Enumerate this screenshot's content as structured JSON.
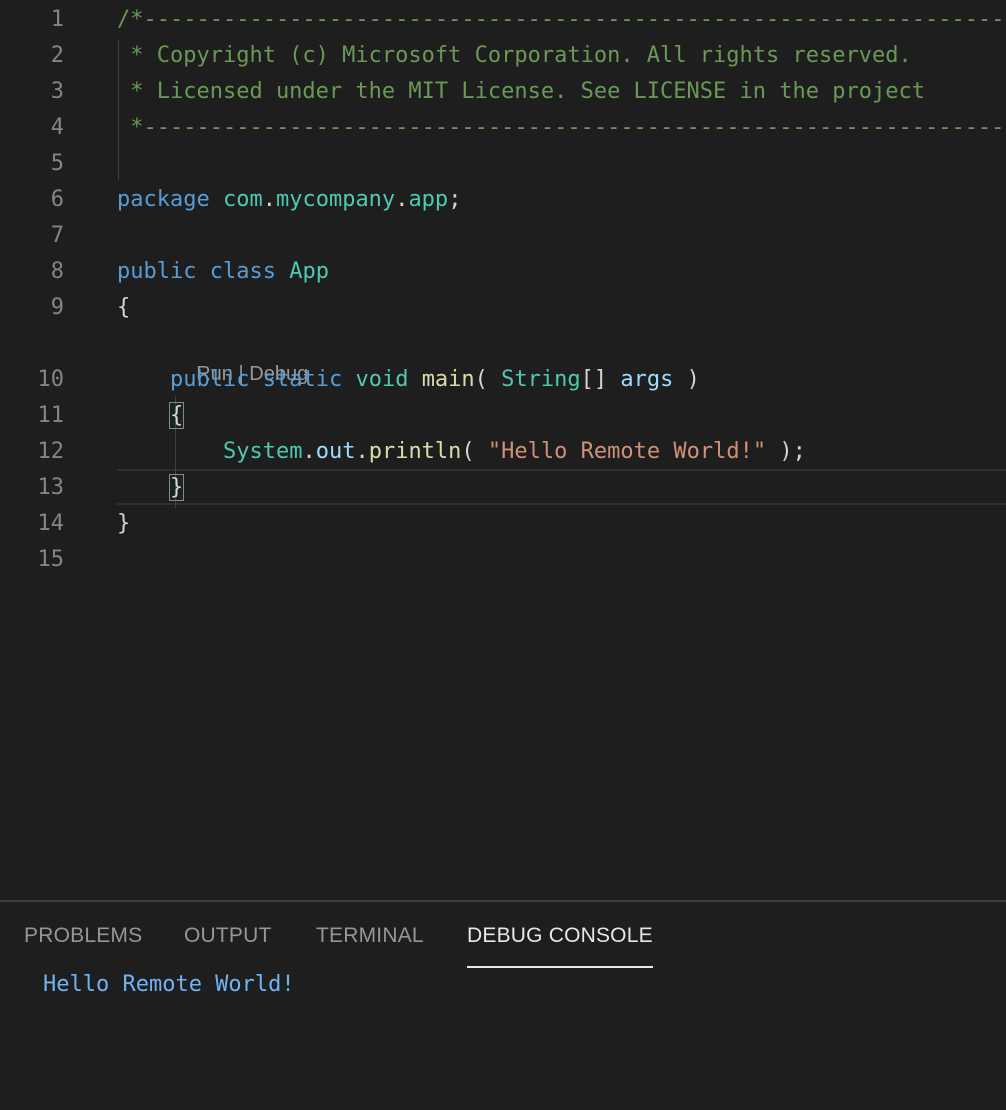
{
  "editor": {
    "language": "java",
    "lines": [
      {
        "number": "1",
        "tokens": [
          {
            "t": "com",
            "v": "/*-----------------------------------------------------------------------"
          }
        ]
      },
      {
        "number": "2",
        "tokens": [
          {
            "t": "com",
            "v": " * Copyright (c) Microsoft Corporation. All rights reserved."
          }
        ]
      },
      {
        "number": "3",
        "tokens": [
          {
            "t": "com",
            "v": " * Licensed under the MIT License. See LICENSE in the project"
          }
        ]
      },
      {
        "number": "4",
        "tokens": [
          {
            "t": "com",
            "v": " *-----------------------------------------------------------------------"
          }
        ]
      },
      {
        "number": "5",
        "tokens": []
      },
      {
        "number": "6",
        "tokens": [
          {
            "t": "kw",
            "v": "package"
          },
          {
            "t": "punc",
            "v": " "
          },
          {
            "t": "type",
            "v": "com"
          },
          {
            "t": "punc",
            "v": "."
          },
          {
            "t": "type",
            "v": "mycompany"
          },
          {
            "t": "punc",
            "v": "."
          },
          {
            "t": "type",
            "v": "app"
          },
          {
            "t": "punc",
            "v": ";"
          }
        ]
      },
      {
        "number": "7",
        "tokens": []
      },
      {
        "number": "8",
        "tokens": [
          {
            "t": "kw",
            "v": "public"
          },
          {
            "t": "punc",
            "v": " "
          },
          {
            "t": "kw",
            "v": "class"
          },
          {
            "t": "punc",
            "v": " "
          },
          {
            "t": "type",
            "v": "App"
          }
        ]
      },
      {
        "number": "9",
        "tokens": [
          {
            "t": "punc",
            "v": "{"
          }
        ]
      },
      {
        "number": "10",
        "tokens": [
          {
            "t": "punc",
            "v": "    "
          },
          {
            "t": "kw",
            "v": "public"
          },
          {
            "t": "punc",
            "v": " "
          },
          {
            "t": "kw",
            "v": "static"
          },
          {
            "t": "punc",
            "v": " "
          },
          {
            "t": "type",
            "v": "void"
          },
          {
            "t": "punc",
            "v": " "
          },
          {
            "t": "fn",
            "v": "main"
          },
          {
            "t": "punc",
            "v": "( "
          },
          {
            "t": "type",
            "v": "String"
          },
          {
            "t": "punc",
            "v": "[] "
          },
          {
            "t": "var",
            "v": "args"
          },
          {
            "t": "punc",
            "v": " )"
          }
        ]
      },
      {
        "number": "11",
        "tokens": [
          {
            "t": "punc",
            "v": "    "
          },
          {
            "t": "bracket",
            "v": "{"
          }
        ]
      },
      {
        "number": "12",
        "tokens": [
          {
            "t": "punc",
            "v": "        "
          },
          {
            "t": "type",
            "v": "System"
          },
          {
            "t": "punc",
            "v": "."
          },
          {
            "t": "var",
            "v": "out"
          },
          {
            "t": "punc",
            "v": "."
          },
          {
            "t": "fn",
            "v": "println"
          },
          {
            "t": "punc",
            "v": "( "
          },
          {
            "t": "str",
            "v": "\"Hello Remote World!\""
          },
          {
            "t": "punc",
            "v": " );"
          }
        ]
      },
      {
        "number": "13",
        "tokens": [
          {
            "t": "punc",
            "v": "    "
          },
          {
            "t": "bracket",
            "v": "}"
          }
        ]
      },
      {
        "number": "14",
        "tokens": [
          {
            "t": "punc",
            "v": "}"
          }
        ]
      },
      {
        "number": "15",
        "tokens": []
      }
    ],
    "codelens": {
      "run": "Run",
      "separator": " | ",
      "debug": "Debug"
    }
  },
  "panel": {
    "tabs": [
      {
        "label": "PROBLEMS",
        "active": false
      },
      {
        "label": "OUTPUT",
        "active": false
      },
      {
        "label": "TERMINAL",
        "active": false
      },
      {
        "label": "DEBUG CONSOLE",
        "active": true
      }
    ],
    "console_output": "Hello Remote World!"
  },
  "colors": {
    "background": "#1e1e1e",
    "comment": "#6a9955",
    "keyword": "#569cd6",
    "type": "#4ec9b0",
    "function": "#dcdcaa",
    "variable": "#9cdcfe",
    "string": "#ce9178",
    "console_text": "#6fb3f2"
  }
}
